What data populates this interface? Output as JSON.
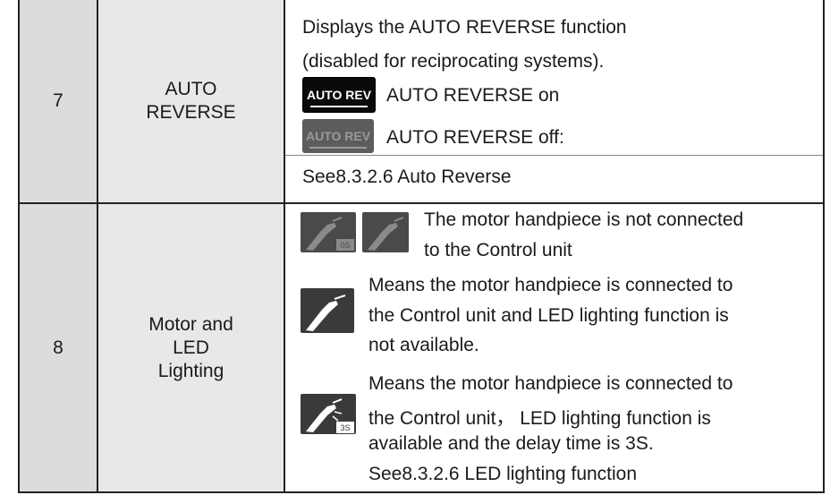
{
  "rows": [
    {
      "number": "7",
      "name_lines": [
        "AUTO",
        "REVERSE"
      ],
      "description": {
        "line1": "Displays the AUTO REVERSE function",
        "line2": "(disabled for reciprocating systems).",
        "on_icon_label": "AUTO REV",
        "on_text": "AUTO  REVERSE  on",
        "off_icon_label": "AUTO REV",
        "off_text": "AUTO REVERSE off:",
        "see_also": "See8.3.2.6 Auto Reverse"
      }
    },
    {
      "number": "8",
      "name_lines": [
        "Motor and",
        "LED",
        "Lighting"
      ],
      "description": {
        "not_connected_line1": "The motor handpiece is not connected",
        "not_connected_line2": "to the Control unit",
        "os_badge": "0S",
        "connected_no_led_line1": "Means the motor handpiece is connected to",
        "connected_no_led_line2": "the Control unit and LED lighting function is",
        "connected_no_led_line3": "not available.",
        "connected_led_line1": "Means the motor handpiece is connected to",
        "connected_led_line2": "the Control unit， LED lighting function is",
        "connected_led_line3": "available and the delay time is 3S.",
        "delay_badge": "3S",
        "see_also": "See8.3.2.6 LED lighting function"
      }
    }
  ],
  "colors": {
    "number_cell_bg": "#dcdcdc",
    "name_cell_bg": "#e8e8e8",
    "icon_dark": "#3a3a3a",
    "border": "#222222"
  }
}
